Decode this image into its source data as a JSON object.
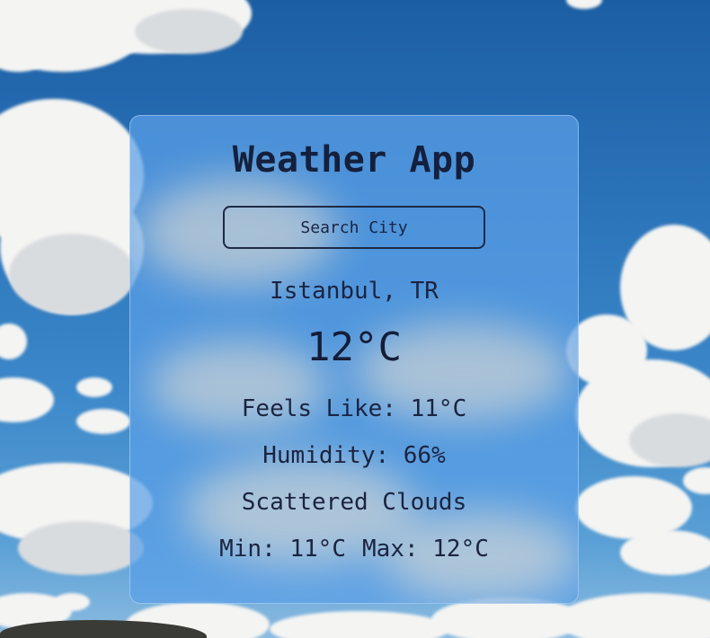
{
  "app": {
    "title": "Weather App"
  },
  "search": {
    "placeholder": "Search City",
    "value": ""
  },
  "weather": {
    "location": "Istanbul, TR",
    "temperature": "12°C",
    "feels_like": "Feels Like: 11°C",
    "humidity": "Humidity: 66%",
    "description": "Scattered Clouds",
    "min": "Min: 11°C",
    "max": "Max: 12°C"
  },
  "theme": {
    "card_color": "#5aa0e8",
    "text_color": "#16213e",
    "sky_color": "#2a72b8"
  }
}
